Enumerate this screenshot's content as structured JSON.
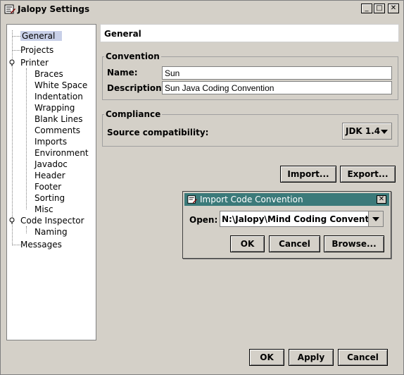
{
  "window": {
    "title": "Jalopy Settings"
  },
  "tree": {
    "items": [
      {
        "label": "General",
        "selected": true
      },
      {
        "label": "Projects"
      },
      {
        "label": "Printer",
        "expanded": true
      },
      {
        "label": "Braces"
      },
      {
        "label": "White Space"
      },
      {
        "label": "Indentation"
      },
      {
        "label": "Wrapping"
      },
      {
        "label": "Blank Lines"
      },
      {
        "label": "Comments"
      },
      {
        "label": "Imports"
      },
      {
        "label": "Environment"
      },
      {
        "label": "Javadoc"
      },
      {
        "label": "Header"
      },
      {
        "label": "Footer"
      },
      {
        "label": "Sorting"
      },
      {
        "label": "Misc"
      },
      {
        "label": "Code Inspector",
        "expanded": true
      },
      {
        "label": "Naming"
      },
      {
        "label": "Messages"
      }
    ]
  },
  "panel": {
    "header": "General",
    "convention": {
      "title": "Convention",
      "name_label": "Name:",
      "name_value": "Sun",
      "description_label": "Description:",
      "description_value": "Sun Java Coding Convention"
    },
    "compliance": {
      "title": "Compliance",
      "source_label": "Source compatibility:",
      "source_value": "JDK 1.4"
    },
    "import_label": "Import...",
    "export_label": "Export..."
  },
  "dialog": {
    "title": "Import Code Convention",
    "open_label": "Open:",
    "open_value": "N:\\Jalopy\\Mind Coding Convention.xml",
    "ok_label": "OK",
    "cancel_label": "Cancel",
    "browse_label": "Browse..."
  },
  "footer": {
    "ok_label": "OK",
    "apply_label": "Apply",
    "cancel_label": "Cancel"
  }
}
